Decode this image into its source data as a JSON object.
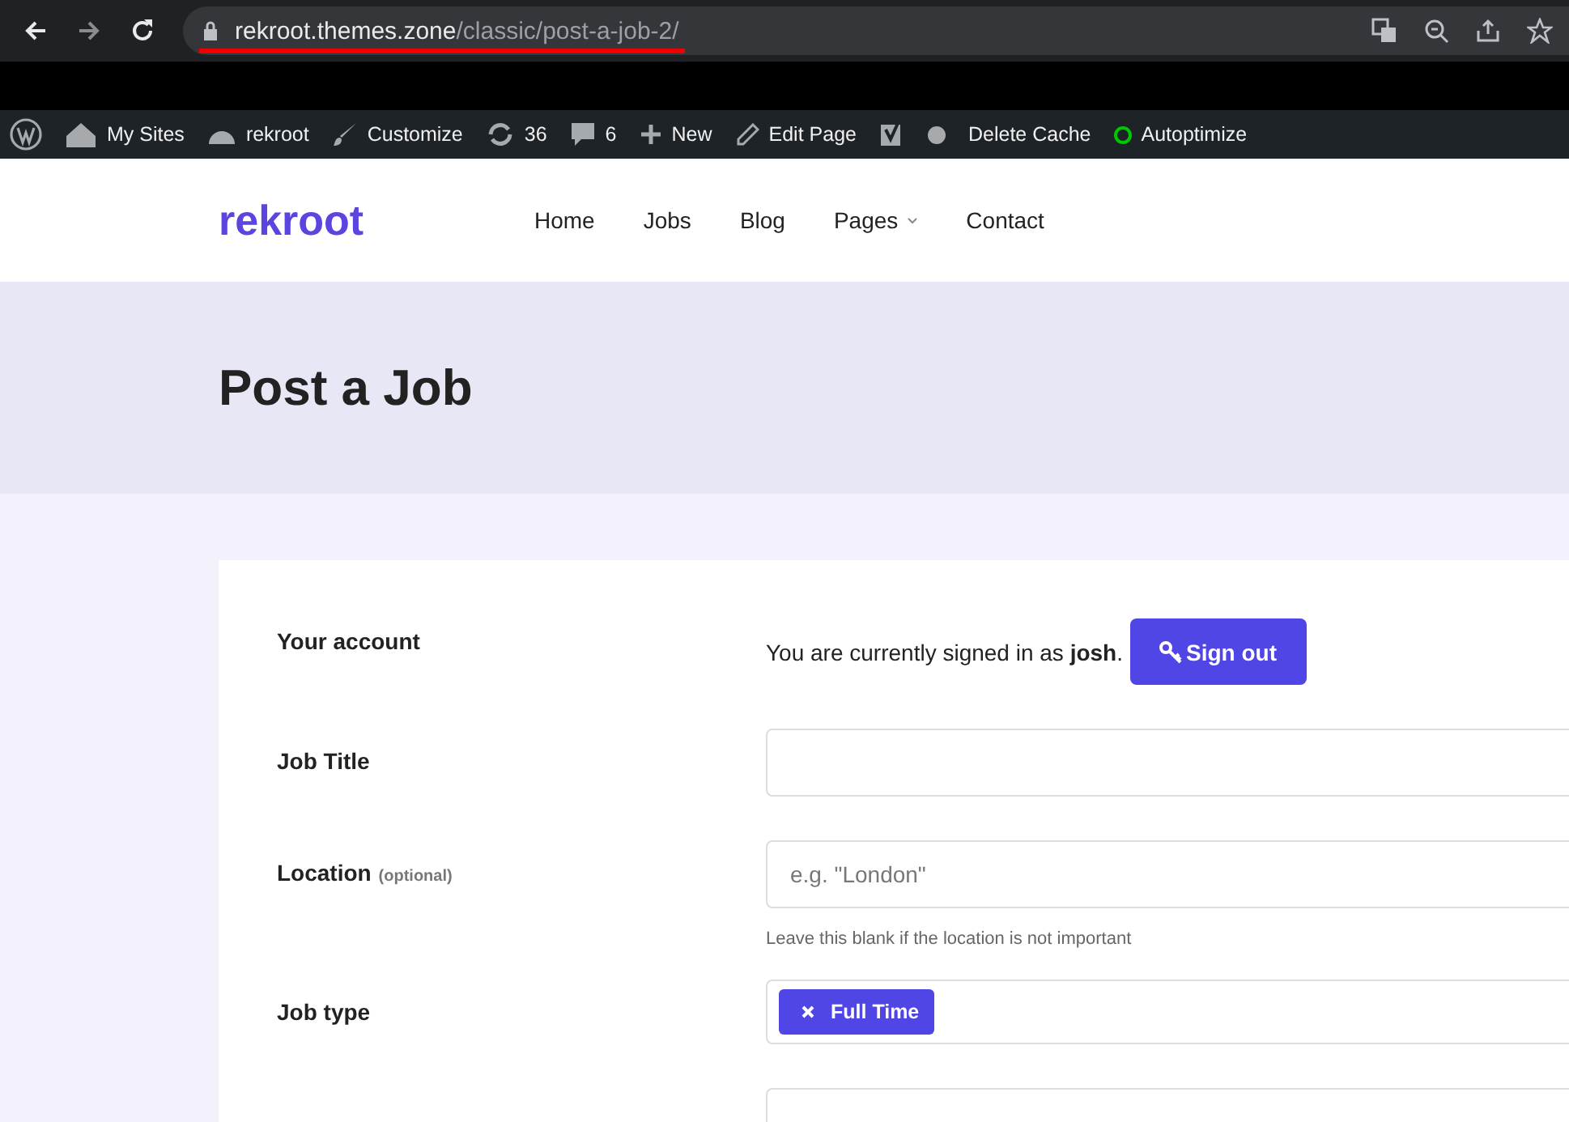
{
  "browser": {
    "url_host": "rekroot.themes.zone",
    "url_path": "/classic/post-a-job-2/"
  },
  "admin_bar": [
    {
      "kind": "logo"
    },
    {
      "kind": "sites",
      "label": "My Sites"
    },
    {
      "kind": "site",
      "label": "rekroot"
    },
    {
      "kind": "customize",
      "label": "Customize"
    },
    {
      "kind": "updates",
      "label": "36"
    },
    {
      "kind": "comments",
      "label": "6"
    },
    {
      "kind": "new",
      "label": "New"
    },
    {
      "kind": "edit",
      "label": "Edit Page"
    },
    {
      "kind": "seo"
    },
    {
      "kind": "dot",
      "color": "#a7aaad"
    },
    {
      "kind": "text",
      "label": "Delete Cache"
    },
    {
      "kind": "ring",
      "label": "Autoptimize",
      "color": "#00c800"
    }
  ],
  "site": {
    "logo": "rekroot",
    "nav": [
      {
        "label": "Home",
        "has_dropdown": false
      },
      {
        "label": "Jobs",
        "has_dropdown": false
      },
      {
        "label": "Blog",
        "has_dropdown": false
      },
      {
        "label": "Pages",
        "has_dropdown": true
      },
      {
        "label": "Contact",
        "has_dropdown": false
      }
    ]
  },
  "page_title": "Post a Job",
  "form": [
    {
      "kind": "account",
      "label": "Your account",
      "text": "You are currently signed in as **josh**.",
      "button": "Sign out"
    },
    {
      "kind": "text",
      "label": "Job Title"
    },
    {
      "kind": "text",
      "label": "Location",
      "note": "(optional)",
      "placeholder": "e.g. \"London\"",
      "hint": "Leave this blank if the location is not important"
    },
    {
      "kind": "tags",
      "label": "Job type",
      "tags": [
        "Full Time"
      ]
    },
    {
      "kind": "text"
    }
  ]
}
